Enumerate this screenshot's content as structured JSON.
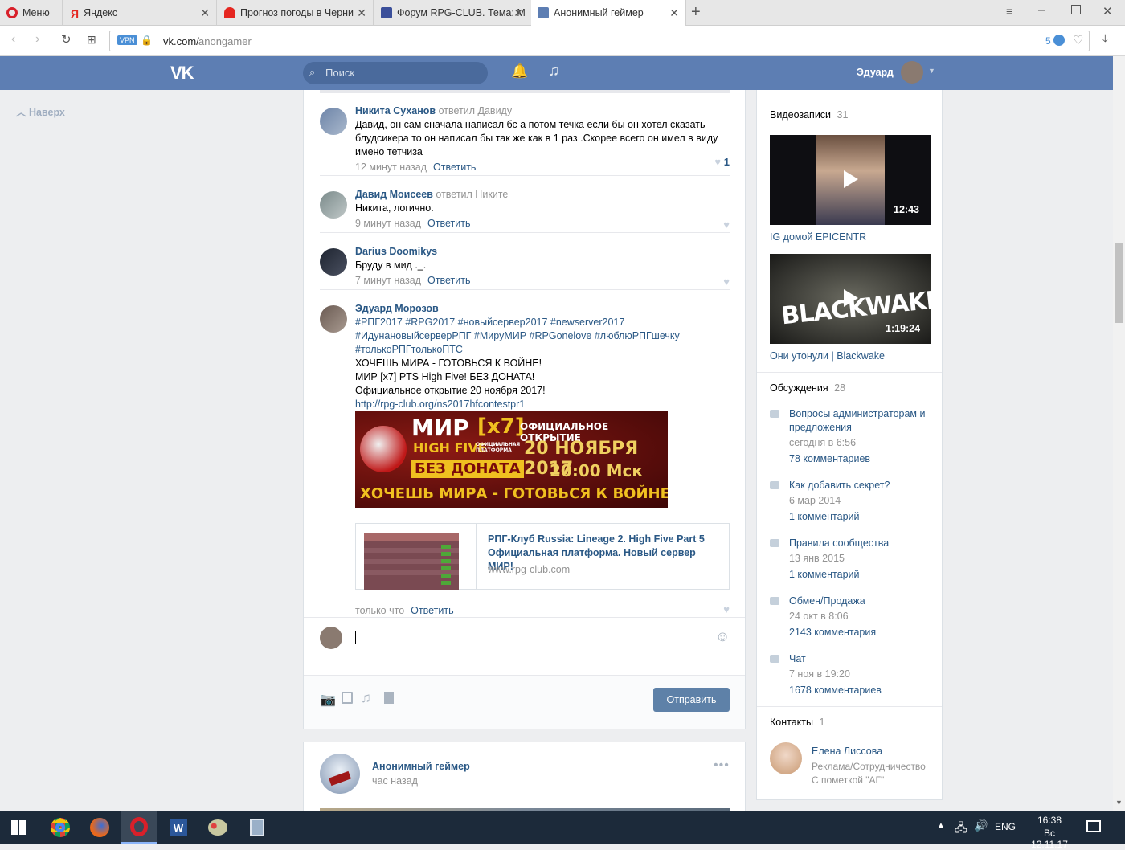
{
  "browser": {
    "menu_label": "Меню",
    "tabs": [
      {
        "title": "Яндекс"
      },
      {
        "title": "Прогноз погоды в Черни"
      },
      {
        "title": "Форум RPG-CLUB. Тема: М"
      },
      {
        "title": "Анонимный геймер"
      }
    ],
    "url_host": "vk.com/",
    "url_path": "anongamer",
    "vpn_label": "VPN",
    "badge_count": "5"
  },
  "vk_header": {
    "logo": "VK",
    "search_placeholder": "Поиск",
    "user_name": "Эдуард"
  },
  "left": {
    "back_to_top": "Наверх"
  },
  "comments": [
    {
      "author": "Никита Суханов",
      "replied": "ответил Давиду",
      "text": "Давид, он сам сначала написал бс а потом течка если бы он хотел сказать блудсикера то он написал бы так же как в 1 раз .Скорее всего он имел в виду имено тетчиза",
      "time": "12 минут назад",
      "reply": "Ответить",
      "likes": "1"
    },
    {
      "author": "Давид Моисеев",
      "replied": "ответил Никите",
      "text": "Никита, логично.",
      "time": "9 минут назад",
      "reply": "Ответить"
    },
    {
      "author": "Darius Doomikys",
      "replied": "",
      "text": "Бруду в мид ._.",
      "time": "7 минут назад",
      "reply": "Ответить"
    },
    {
      "author": "Эдуард Морозов",
      "replied": "",
      "hashtags": "#РПГ2017 #RPG2017 #новыйсервер2017 #newserver2017 #ИдунановыйсерверРПГ #МируМИР #RPGonelove #люблюРПГшечку #толькоРПГтолькоПТС",
      "line1": "ХОЧЕШЬ МИРА - ГОТОВЬСЯ К ВОЙНЕ!",
      "line2": "МИР [x7] PTS High Five! БЕЗ ДОНАТА!",
      "line3": "Официальное открытие 20 ноября 2017!",
      "url": "http://rpg-club.org/ns2017hfcontestpr1",
      "time": "только что",
      "reply": "Ответить"
    }
  ],
  "banner": {
    "mir": "МИР",
    "x7": "[x7]",
    "open": "ОФИЦИАЛЬНОЕ ОТКРЫТИЕ",
    "highfive": "HIGH FIVE",
    "platform": "ОФИЦИАЛЬНАЯ ПЛАТФОРМА",
    "date": "20 НОЯБРЯ 2017",
    "nodonat": "БЕЗ ДОНАТА",
    "time": "20:00 Мск",
    "war": "ХОЧЕШЬ МИРА - ГОТОВЬСЯ К ВОЙНЕ"
  },
  "link_preview": {
    "title": "РПГ-Клуб Russia: Lineage 2. High Five Part 5 Официальная платформа. Новый сервер МИР!",
    "domain": "www.rpg-club.com"
  },
  "composer": {
    "send_label": "Отправить"
  },
  "next_post": {
    "author": "Анонимный геймер",
    "time": "час назад"
  },
  "right": {
    "videos_title": "Видеозаписи",
    "videos_count": "31",
    "videos": [
      {
        "duration": "12:43",
        "title": "IG домой EPICENTR"
      },
      {
        "duration": "1:19:24",
        "title": "Они утонули | Blackwake",
        "thumb_text": "BLACKWAKE"
      }
    ],
    "discussions_title": "Обсуждения",
    "discussions_count": "28",
    "discussions": [
      {
        "title": "Вопросы администраторам и предложения",
        "date": "сегодня в 6:56",
        "comments": "78 комментариев"
      },
      {
        "title": "Как добавить секрет?",
        "date": "6 мар 2014",
        "comments": "1 комментарий"
      },
      {
        "title": "Правила сообщества",
        "date": "13 янв 2015",
        "comments": "1 комментарий"
      },
      {
        "title": "Обмен/Продажа",
        "date": "24 окт в 8:06",
        "comments": "2143 комментария"
      },
      {
        "title": "Чат",
        "date": "7 ноя в 19:20",
        "comments": "1678 комментариев"
      }
    ],
    "contacts_title": "Контакты",
    "contacts_count": "1",
    "contact": {
      "name": "Елена Лиссова",
      "role": "Реклама/Сотрудничество",
      "note": "С пометкой \"АГ\""
    }
  },
  "taskbar": {
    "lang": "ENG",
    "time": "16:38",
    "date": "Вс 12.11.17"
  },
  "colors": {
    "vk_blue": "#5d7eb3",
    "link": "#2a5885",
    "button": "#5e81a8"
  }
}
